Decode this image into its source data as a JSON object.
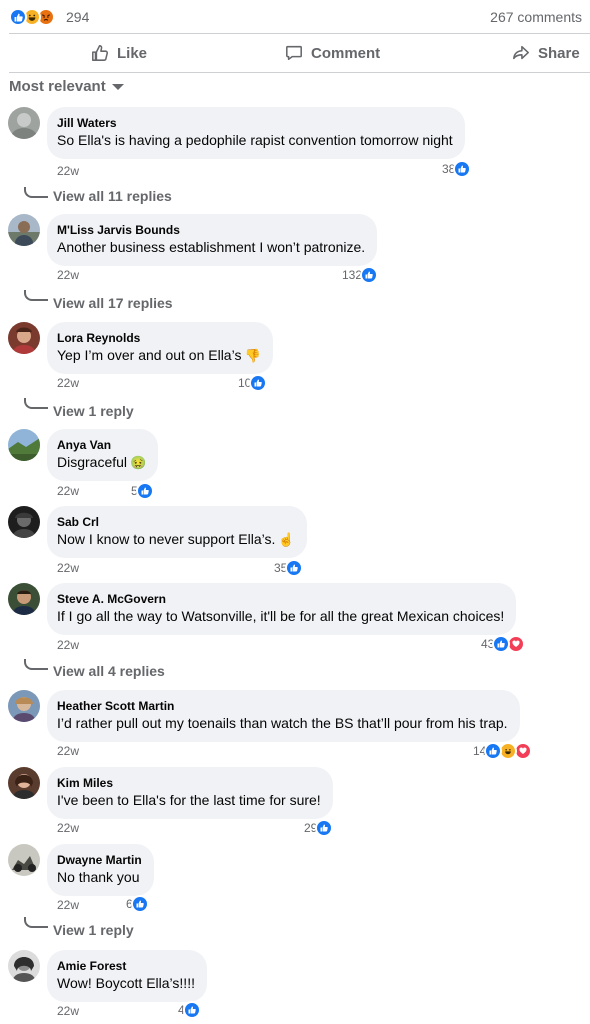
{
  "reactions": {
    "icons": [
      "like-icon",
      "haha-icon",
      "angry-icon"
    ],
    "total": "294",
    "comments": "267 comments"
  },
  "actions": {
    "like": "Like",
    "comment": "Comment",
    "share": "Share"
  },
  "sort": {
    "label": "Most relevant"
  },
  "colors": {
    "accent": "#1877f2",
    "bubble": "#f0f2f5",
    "muted": "#65676b",
    "love": "#f33e58",
    "haha": "#f7b125"
  },
  "comments": [
    {
      "author": "Jill Waters",
      "text": "So Ella's is having a pedophile rapist convention tomorrow night",
      "time": "22w",
      "likes": "38",
      "reactions": [
        "like"
      ],
      "replies": "View all 11 replies"
    },
    {
      "author": "M'Liss Jarvis Bounds",
      "text": "Another business establishment I won’t patronize.",
      "time": "22w",
      "likes": "132",
      "reactions": [
        "like"
      ],
      "replies": "View all 17 replies"
    },
    {
      "author": "Lora Reynolds",
      "text": "Yep I’m over and out on Ella’s",
      "emoji": "thumbs-down-emoji",
      "time": "22w",
      "likes": "10",
      "reactions": [
        "like"
      ],
      "replies": "View 1 reply"
    },
    {
      "author": "Anya Van",
      "text": "Disgraceful",
      "emoji": "nauseated-face-emoji",
      "time": "22w",
      "likes": "5",
      "reactions": [
        "like"
      ],
      "replies": ""
    },
    {
      "author": "Sab Crl",
      "text": "Now I know to never support Ella’s.",
      "emoji": "pointing-up-emoji",
      "time": "22w",
      "likes": "35",
      "reactions": [
        "like"
      ],
      "replies": ""
    },
    {
      "author": "Steve A. McGovern",
      "text": "If I go all the way to Watsonville, it'll be for all the great Mexican choices!",
      "time": "22w",
      "likes": "43",
      "reactions": [
        "like",
        "love"
      ],
      "replies": "View all 4 replies"
    },
    {
      "author": "Heather Scott Martin",
      "text": "I’d rather pull out my toenails than watch the BS that’ll pour from his trap.",
      "time": "22w",
      "likes": "14",
      "reactions": [
        "like",
        "haha",
        "love"
      ],
      "replies": ""
    },
    {
      "author": "Kim Miles",
      "text": "I've been to Ella's for the last time for sure!",
      "time": "22w",
      "likes": "29",
      "reactions": [
        "like"
      ],
      "replies": ""
    },
    {
      "author": "Dwayne Martin",
      "text": "No thank you",
      "time": "22w",
      "likes": "6",
      "reactions": [
        "like"
      ],
      "replies": "View 1 reply"
    },
    {
      "author": "Amie Forest",
      "text": "Wow! Boycott Ella’s!!!!",
      "time": "22w",
      "likes": "4",
      "reactions": [
        "like"
      ],
      "replies": ""
    }
  ]
}
